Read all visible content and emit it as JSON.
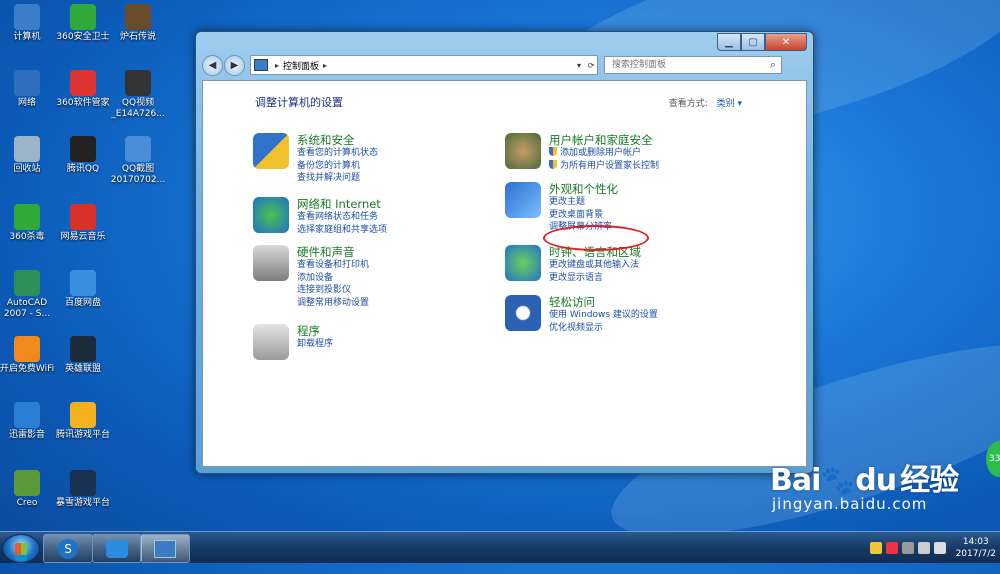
{
  "desktop": {
    "icons": [
      {
        "label": "计算机",
        "icon": "computer-icon",
        "color": "#3b7dc9"
      },
      {
        "label": "360安全卫士",
        "icon": "360-safe-icon",
        "color": "#2faa3a"
      },
      {
        "label": "炉石传说",
        "icon": "hearthstone-icon",
        "color": "#6b4c2a"
      },
      {
        "label": "网络",
        "icon": "network-icon",
        "color": "#2e6fbd"
      },
      {
        "label": "360软件管家",
        "icon": "360-software-icon",
        "color": "#d33"
      },
      {
        "label": "QQ视频_E14A726...",
        "icon": "qq-video-icon",
        "color": "#333"
      },
      {
        "label": "回收站",
        "icon": "recycle-bin-icon",
        "color": "#9bb4c8"
      },
      {
        "label": "腾讯QQ",
        "icon": "qq-penguin-icon",
        "color": "#222"
      },
      {
        "label": "QQ截图20170702...",
        "icon": "qq-screenshot-icon",
        "color": "#4a8ed8"
      },
      {
        "label": "360杀毒",
        "icon": "360-antivirus-icon",
        "color": "#2faa3a"
      },
      {
        "label": "网易云音乐",
        "icon": "netease-music-icon",
        "color": "#d8312a"
      },
      {
        "label": "AutoCAD 2007 - S...",
        "icon": "autocad-icon",
        "color": "#2d8f5a"
      },
      {
        "label": "百度网盘",
        "icon": "baidu-netdisk-icon",
        "color": "#3a8fe0"
      },
      {
        "label": "开启免费WiFi",
        "icon": "wifi-icon",
        "color": "#f08a1c"
      },
      {
        "label": "英雄联盟",
        "icon": "lol-icon",
        "color": "#1b2a3a"
      },
      {
        "label": "迅雷影音",
        "icon": "xunlei-player-icon",
        "color": "#2a7fd4"
      },
      {
        "label": "腾讯游戏平台",
        "icon": "tencent-games-icon",
        "color": "#f3b21e"
      },
      {
        "label": "Creo",
        "icon": "creo-icon",
        "color": "#5a9a3a"
      },
      {
        "label": "暴雪游戏平台",
        "icon": "battlenet-icon",
        "color": "#1a3050"
      }
    ]
  },
  "window": {
    "address": {
      "crumb": "控制面板"
    },
    "search": {
      "placeholder": "搜索控制面板"
    },
    "page_title": "调整计算机的设置",
    "view_by": {
      "label": "查看方式:",
      "value": "类别 ▾"
    },
    "categories_left": [
      {
        "title": "系统和安全",
        "icon": "shield-icon",
        "links": [
          "查看您的计算机状态",
          "备份您的计算机",
          "查找并解决问题"
        ]
      },
      {
        "title": "网络和 Internet",
        "icon": "globe-network-icon",
        "links": [
          "查看网络状态和任务",
          "选择家庭组和共享选项"
        ]
      },
      {
        "title": "硬件和声音",
        "icon": "printer-icon",
        "links": [
          "查看设备和打印机",
          "添加设备",
          "连接到投影仪",
          "调整常用移动设置"
        ]
      },
      {
        "title": "程序",
        "icon": "programs-icon",
        "links": [
          "卸载程序"
        ]
      }
    ],
    "categories_right": [
      {
        "title": "用户帐户和家庭安全",
        "icon": "users-icon",
        "links": [
          "添加或删除用户帐户",
          "为所有用户设置家长控制"
        ]
      },
      {
        "title": "外观和个性化",
        "icon": "appearance-icon",
        "links": [
          "更改主题",
          "更改桌面背景",
          "调整屏幕分辨率"
        ]
      },
      {
        "title": "时钟、语言和区域",
        "icon": "clock-globe-icon",
        "links": [
          "更改键盘或其他输入法",
          "更改显示语言"
        ]
      },
      {
        "title": "轻松访问",
        "icon": "accessibility-icon",
        "links": [
          "使用 Windows 建议的设置",
          "优化视频显示"
        ]
      }
    ]
  },
  "taskbar": {
    "clock_time": "14:03",
    "clock_date": "2017/7/2"
  },
  "watermark": {
    "logo": "Bai",
    "logo2": "du",
    "logo3": "经验",
    "url": "jingyan.baidu.com",
    "badge": "33"
  },
  "colors": {
    "link": "#1d4fa6",
    "category_title": "#1a7b25",
    "highlight": "#dd2222"
  }
}
